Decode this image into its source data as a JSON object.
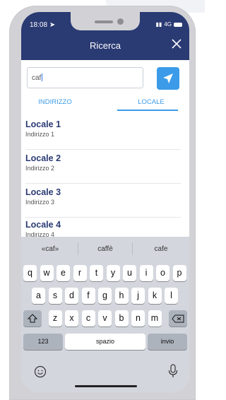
{
  "status_bar": {
    "time": "18:08",
    "network": "4G"
  },
  "header": {
    "title": "Ricerca"
  },
  "search": {
    "value": "caf"
  },
  "tabs": [
    {
      "label": "INDIRIZZO"
    },
    {
      "label": "LOCALE"
    }
  ],
  "results": [
    {
      "name": "Locale 1",
      "address": "Indirizzo 1"
    },
    {
      "name": "Locale 2",
      "address": "Indirizzo 2"
    },
    {
      "name": "Locale 3",
      "address": "Indirizzo 3"
    },
    {
      "name": "Locale 4",
      "address": "Indirizzo 4"
    }
  ],
  "keyboard": {
    "suggestions": [
      "«caf»",
      "caffè",
      "cafe"
    ],
    "row1": [
      "q",
      "w",
      "e",
      "r",
      "t",
      "y",
      "u",
      "i",
      "o",
      "p"
    ],
    "row2": [
      "a",
      "s",
      "d",
      "f",
      "g",
      "h",
      "j",
      "k",
      "l"
    ],
    "row3": [
      "z",
      "x",
      "c",
      "v",
      "b",
      "n",
      "m"
    ],
    "numbers_label": "123",
    "space_label": "spazio",
    "return_label": "invio"
  },
  "colors": {
    "header": "#2a3a73",
    "accent": "#3b9be8"
  },
  "icons": [
    "close-icon",
    "send-icon",
    "shift-icon",
    "backspace-icon",
    "emoji-icon",
    "mic-icon"
  ]
}
